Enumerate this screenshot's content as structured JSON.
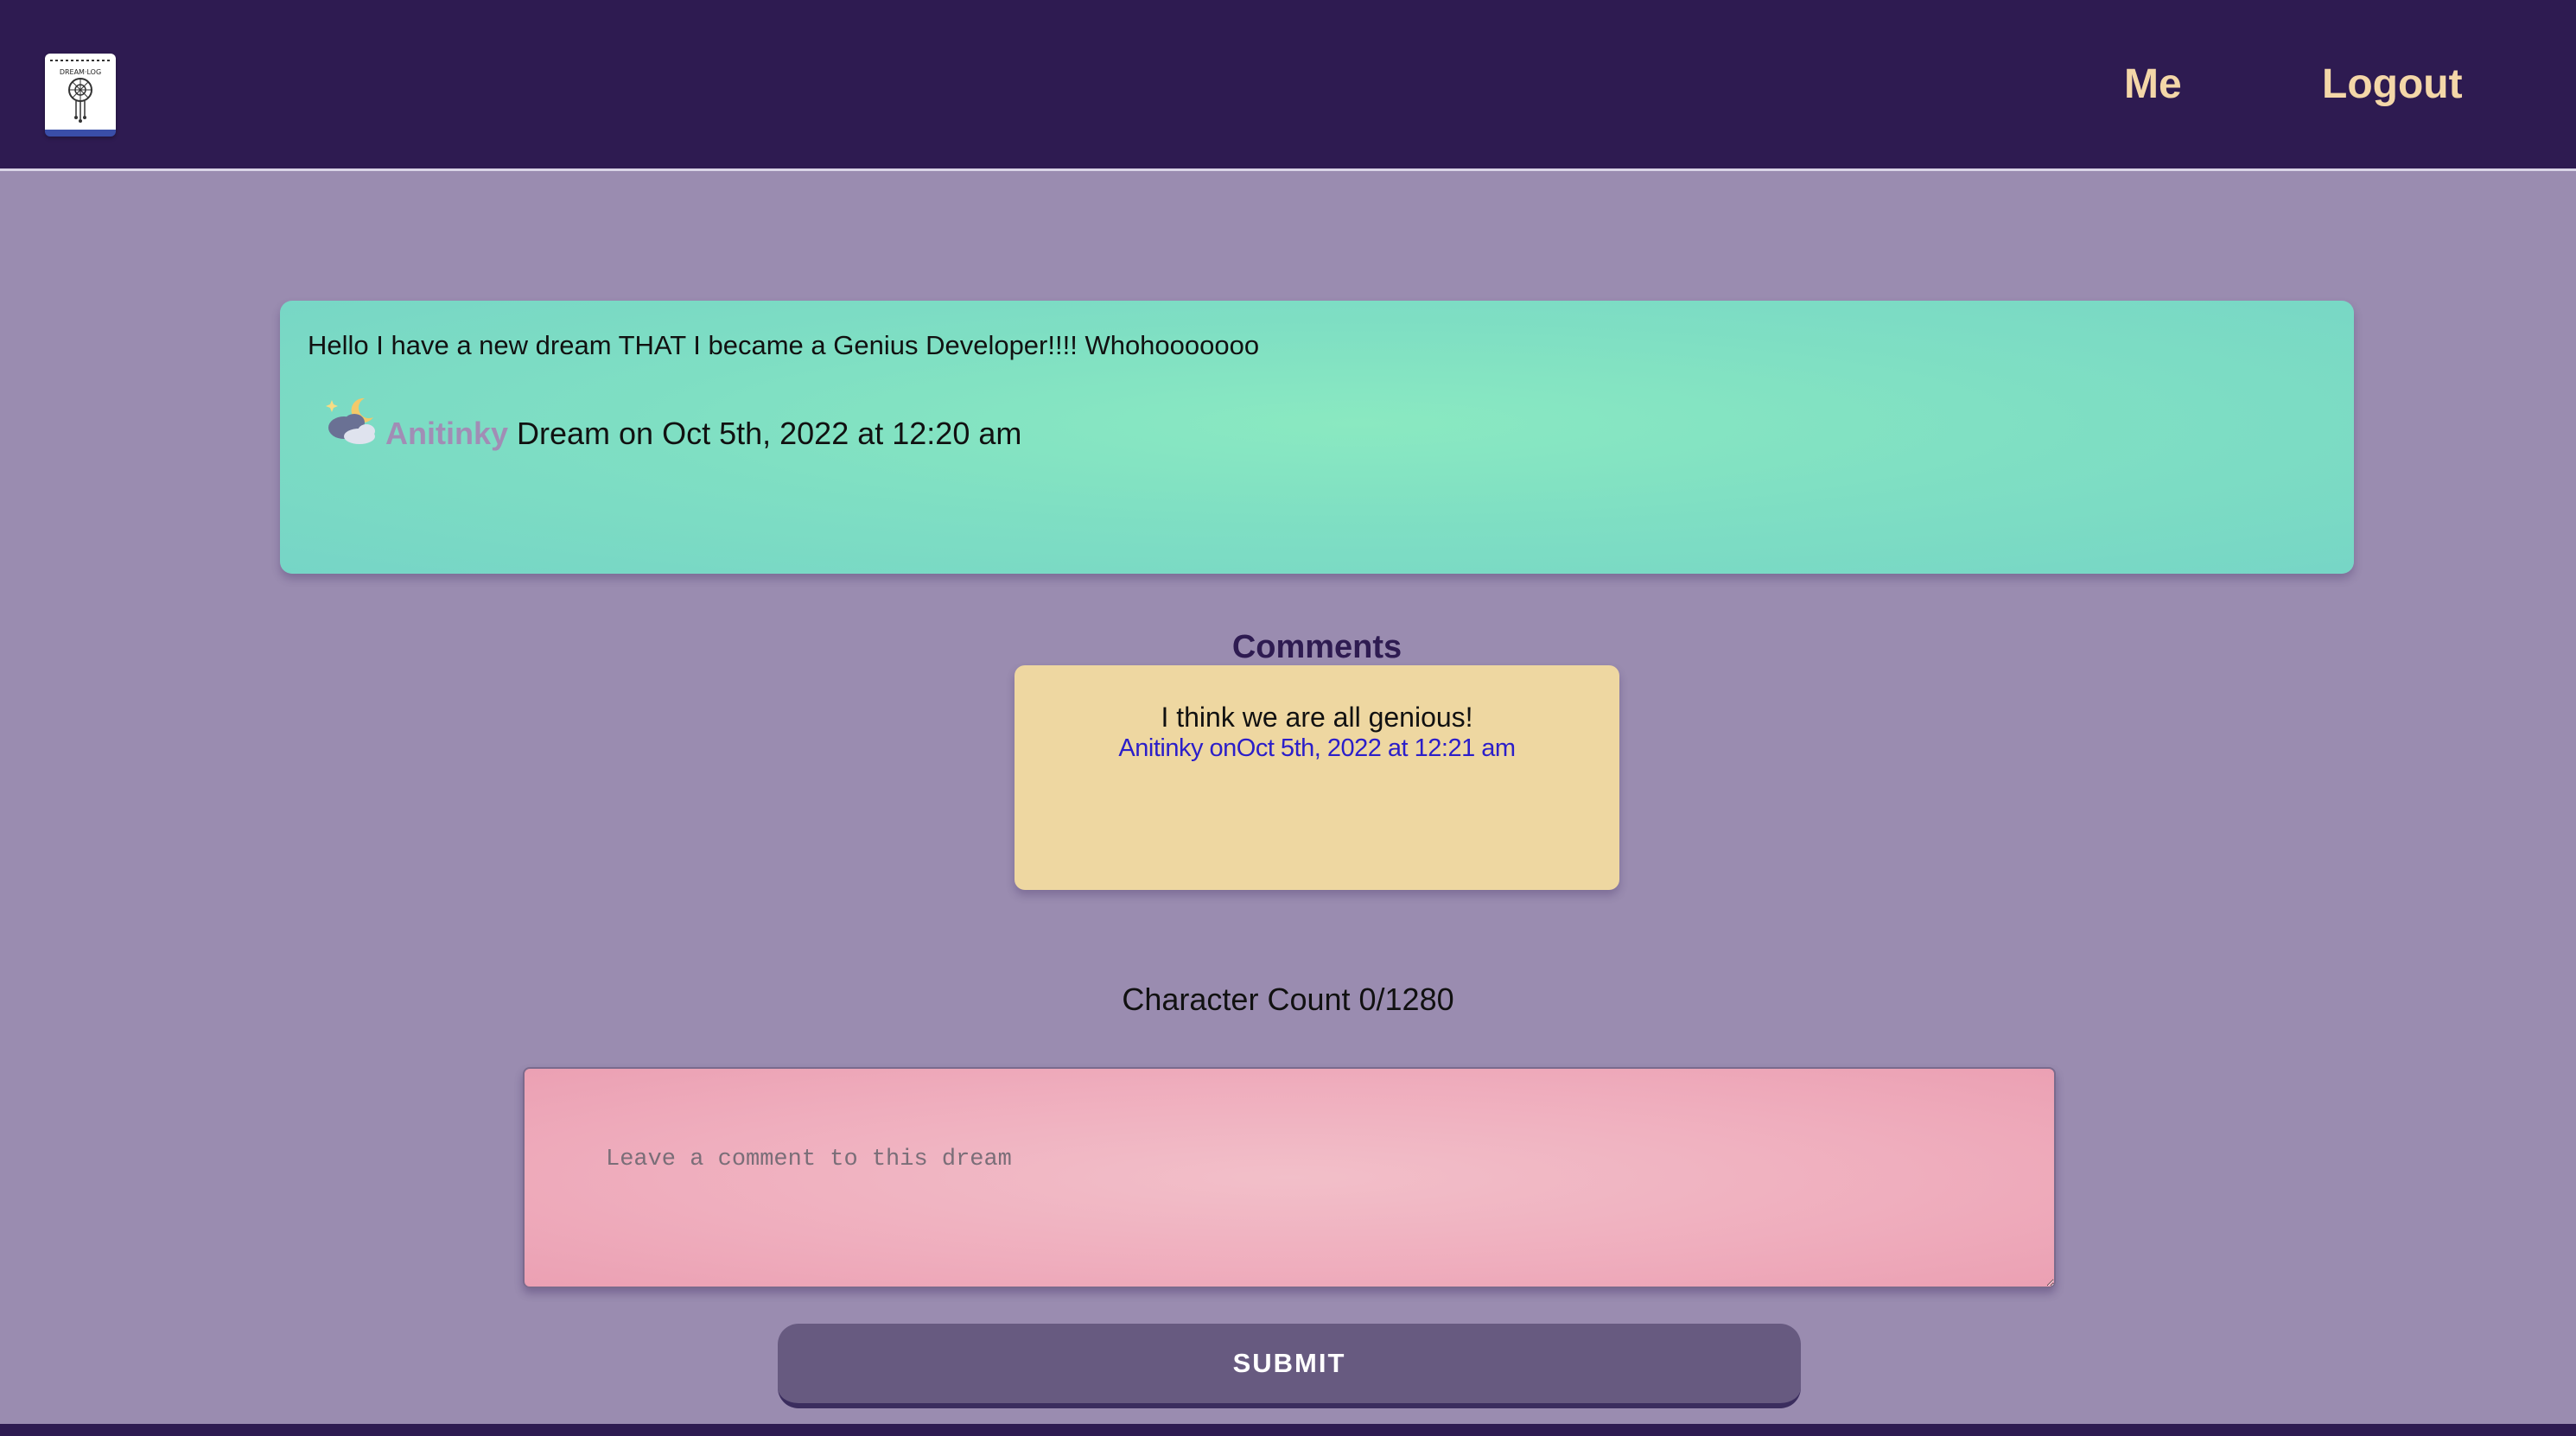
{
  "header": {
    "logo_icon": "dream-catcher-notebook-icon",
    "nav": {
      "me_label": "Me",
      "logout_label": "Logout"
    }
  },
  "dream": {
    "text": "Hello I have a new dream THAT I became a Genius Developer!!!! Whohooooooo",
    "weather_icon": "night-cloud-moon-icon",
    "author": "Anitinky",
    "date_text": "Dream on Oct 5th, 2022 at 12:20 am"
  },
  "comments": {
    "title": "Comments",
    "items": [
      {
        "text": "I think we are all genious!",
        "meta": "Anitinky onOct 5th, 2022 at 12:21 am"
      }
    ]
  },
  "form": {
    "char_count": "Character Count 0/1280",
    "placeholder": "Leave a comment to this dream",
    "submit_label": "SUBMIT"
  },
  "colors": {
    "navbar": "#2e1b51",
    "page_bg": "#9a8cb0",
    "nav_link": "#f4d7a8",
    "dream_card": "#7fdfc3",
    "comment_card": "#eed7a1",
    "comment_meta": "#2b1ec9",
    "input_bg": "#efadbd",
    "submit_bg": "#675a80"
  }
}
